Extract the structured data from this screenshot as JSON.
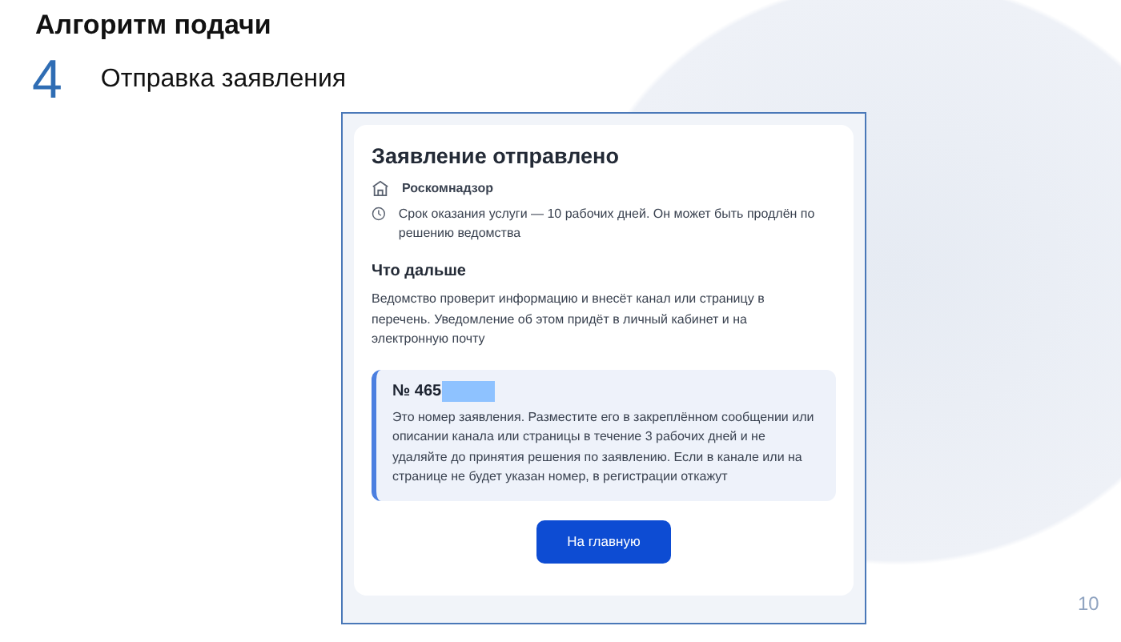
{
  "slide": {
    "title": "Алгоритм подачи",
    "step_number": "4",
    "step_title": "Отправка заявления",
    "page_number": "10"
  },
  "screen": {
    "title": "Заявление отправлено",
    "info": [
      {
        "kind": "agency",
        "text": "Роскомнадзор"
      },
      {
        "kind": "deadline",
        "text": "Срок оказания услуги — 10 рабочих дней. Он может быть продлён по решению ведомства"
      }
    ],
    "next_heading": "Что дальше",
    "next_text": "Ведомство проверит информацию и внесёт канал или страницу в перечень. Уведомление об этом придёт в личный кабинет и на электронную почту",
    "notice": {
      "number": "№ 465",
      "redacted": true,
      "text": "Это номер заявления. Разместите его в закреплённом сообщении или описании канала или страницы в течение 3 рабочих дней и не удаляйте до принятия решения по заявлению. Если в канале или на странице не будет указан номер, в регистрации откажут"
    },
    "button": "На главную"
  }
}
